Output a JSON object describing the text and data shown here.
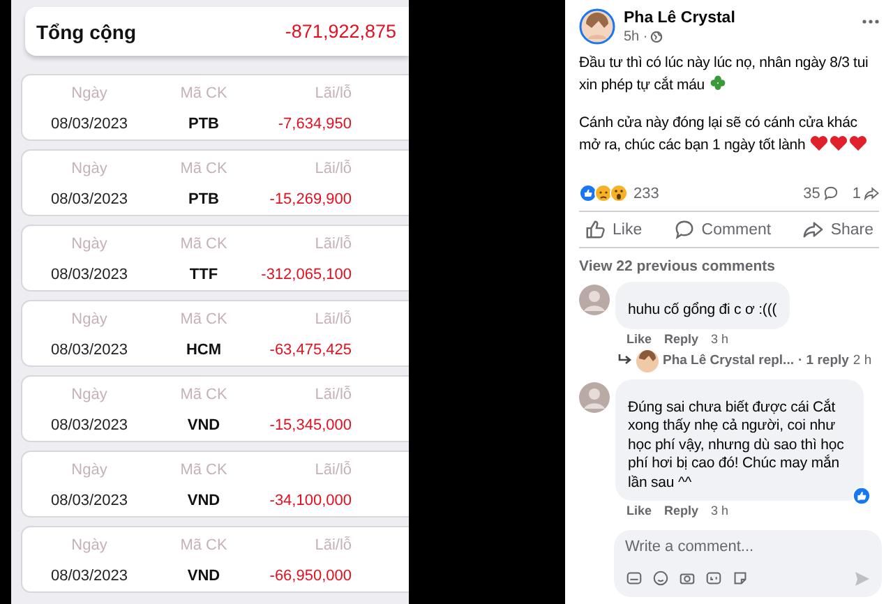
{
  "summary": {
    "label": "Tổng cộng",
    "value": "-871,922,875"
  },
  "trades": [
    {
      "date_label": "Ngày",
      "symbol_label": "Mã CK",
      "pnl_label": "Lãi/lỗ",
      "date": "08/03/2023",
      "symbol": "PTB",
      "pnl": "-7,634,950"
    },
    {
      "date_label": "Ngày",
      "symbol_label": "Mã CK",
      "pnl_label": "Lãi/lỗ",
      "date": "08/03/2023",
      "symbol": "PTB",
      "pnl": "-15,269,900"
    },
    {
      "date_label": "Ngày",
      "symbol_label": "Mã CK",
      "pnl_label": "Lãi/lỗ",
      "date": "08/03/2023",
      "symbol": "TTF",
      "pnl": "-312,065,100"
    },
    {
      "date_label": "Ngày",
      "symbol_label": "Mã CK",
      "pnl_label": "Lãi/lỗ",
      "date": "08/03/2023",
      "symbol": "HCM",
      "pnl": "-63,475,425"
    },
    {
      "date_label": "Ngày",
      "symbol_label": "Mã CK",
      "pnl_label": "Lãi/lỗ",
      "date": "08/03/2023",
      "symbol": "VND",
      "pnl": "-15,345,000"
    },
    {
      "date_label": "Ngày",
      "symbol_label": "Mã CK",
      "pnl_label": "Lãi/lỗ",
      "date": "08/03/2023",
      "symbol": "VND",
      "pnl": "-34,100,000"
    },
    {
      "date_label": "Ngày",
      "symbol_label": "Mã CK",
      "pnl_label": "Lãi/lỗ",
      "date": "08/03/2023",
      "symbol": "VND",
      "pnl": "-66,950,000"
    }
  ],
  "post": {
    "author": "Pha Lê Crystal",
    "time": "5h ·",
    "paragraphs": [
      {
        "text": "Đầu tư thì có lúc này lúc nọ, nhân ngày 8/3 tui xin phép tự cắt máu"
      },
      {
        "text": "Cánh cửa này đóng lại sẽ có cánh cửa khác mở ra, chúc các bạn 1 ngày tốt lành"
      }
    ],
    "reaction_count": "233",
    "comment_count": "35",
    "share_count": "1",
    "actions": [
      {
        "kind": "like",
        "label": "Like"
      },
      {
        "kind": "comment",
        "label": "Comment"
      },
      {
        "kind": "share",
        "label": "Share"
      }
    ],
    "view_more": "View 22 previous comments",
    "comments": [
      {
        "text": "huhu cố gổng đi c ơ :(((",
        "liked": false,
        "actions": [
          "Like",
          "Reply"
        ],
        "time": "3 h",
        "reply": {
          "author": "Pha Lê Crystal repl...",
          "count": "· 1 reply",
          "time": "2 h"
        }
      },
      {
        "text": "Đúng sai chưa biết được cái Cắt xong thấy nhẹ cả người, coi như học phí vậy, nhưng dù sao thì học phí hơi bị cao đó! Chúc may mắn lần sau ^^",
        "liked": true,
        "actions": [
          "Like",
          "Reply"
        ],
        "time": "3 h"
      }
    ],
    "composer": {
      "placeholder": "Write a comment..."
    }
  }
}
